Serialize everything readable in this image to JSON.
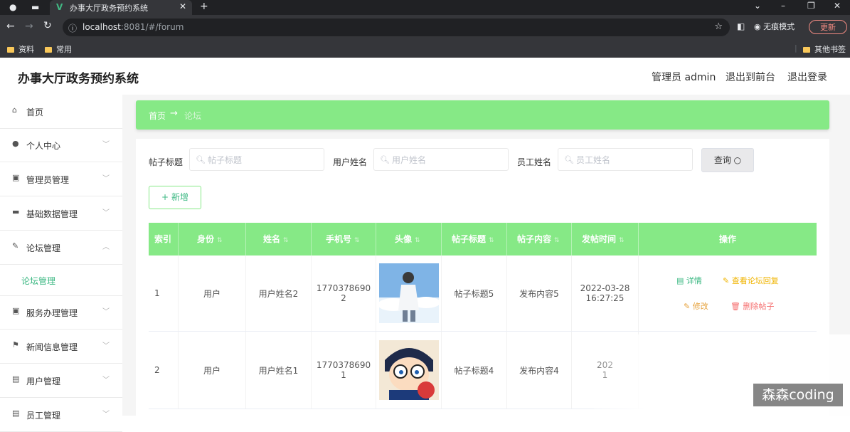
{
  "browser": {
    "tab_title": "办事大厅政务预约系统",
    "url_host": "localhost",
    "url_rest": ":8081/#/forum",
    "incognito_label": "无痕模式",
    "update_label": "更新",
    "bookmarks": [
      "资料",
      "常用"
    ],
    "other_bookmarks": "其他书签"
  },
  "header": {
    "title": "办事大厅政务预约系统",
    "admin": "管理员 admin",
    "front": "退出到前台",
    "logout": "退出登录"
  },
  "sidebar": {
    "items": [
      {
        "label": "首页",
        "icon": "home-icon"
      },
      {
        "label": "个人中心",
        "icon": "user-icon"
      },
      {
        "label": "管理员管理",
        "icon": "admin-icon"
      },
      {
        "label": "基础数据管理",
        "icon": "monitor-icon"
      },
      {
        "label": "论坛管理",
        "icon": "forum-icon"
      },
      {
        "label": "服务办理管理",
        "icon": "service-icon"
      },
      {
        "label": "新闻信息管理",
        "icon": "flag-icon"
      },
      {
        "label": "用户管理",
        "icon": "users-icon"
      },
      {
        "label": "员工管理",
        "icon": "staff-icon"
      }
    ],
    "sub_active": "论坛管理"
  },
  "breadcrumb": {
    "home": "首页",
    "current": "论坛"
  },
  "search": {
    "title_label": "帖子标题",
    "title_placeholder": "帖子标题",
    "user_label": "用户姓名",
    "user_placeholder": "用户姓名",
    "staff_label": "员工姓名",
    "staff_placeholder": "员工姓名",
    "query_label": "查询"
  },
  "add_label": "新增",
  "table": {
    "headers": [
      "索引",
      "身份",
      "姓名",
      "手机号",
      "头像",
      "帖子标题",
      "帖子内容",
      "发帖时间",
      "操作"
    ],
    "rows": [
      {
        "index": "1",
        "role": "用户",
        "name": "用户姓名2",
        "phone_a": "1770378690",
        "phone_b": "2",
        "title": "帖子标题5",
        "content": "发布内容5",
        "date": "2022-03-28",
        "time": "16:27:25",
        "avatar": "anime-boy-sky"
      },
      {
        "index": "2",
        "role": "用户",
        "name": "用户姓名1",
        "phone_a": "1770378690",
        "phone_b": "1",
        "title": "帖子标题4",
        "content": "发布内容4",
        "date": "202",
        "time": "1",
        "avatar": "anime-detective"
      }
    ],
    "actions": {
      "detail": "详情",
      "view_replies": "查看论坛回复",
      "edit": "修改",
      "delete": "删除帖子"
    }
  },
  "watermark": "森森coding",
  "colors": {
    "accent": "#86e986",
    "accent_text": "#3cb883",
    "detail": "#3cb883",
    "view": "#f0b400",
    "edit": "#e6a23c",
    "delete": "#f56c6c"
  }
}
